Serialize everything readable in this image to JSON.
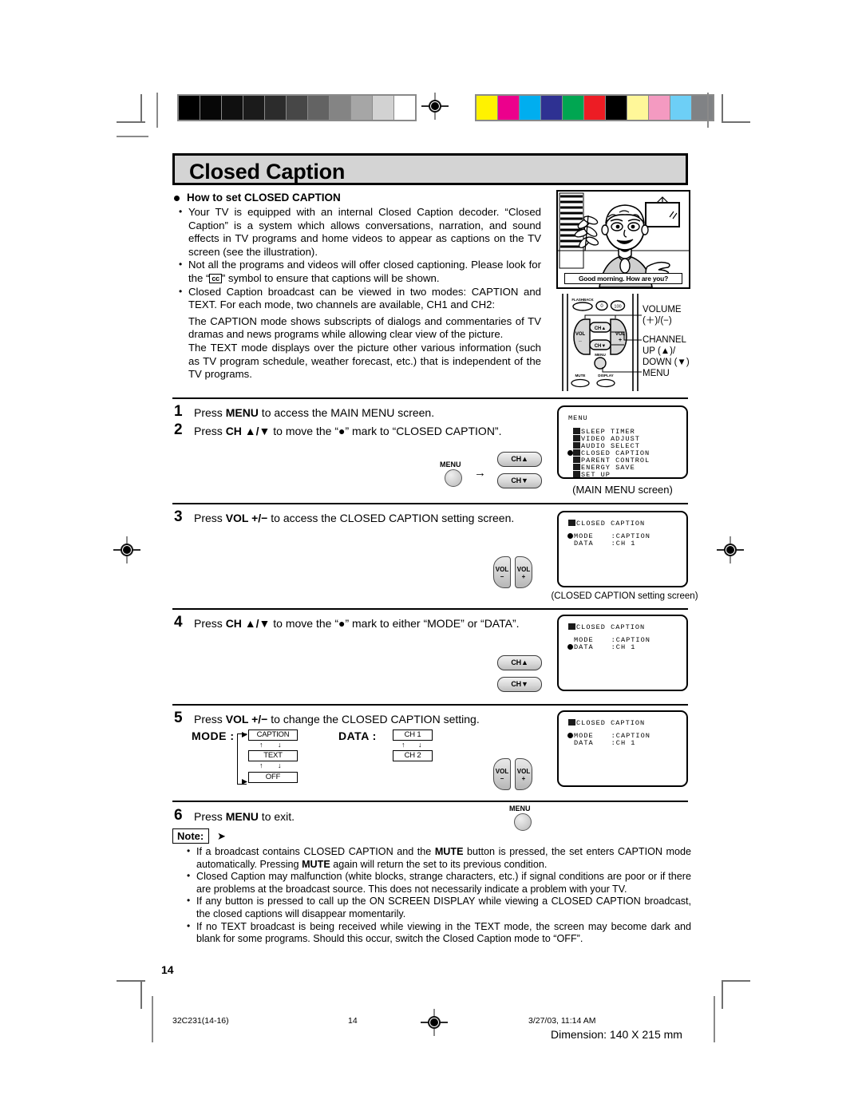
{
  "document": {
    "title": "Closed Caption",
    "page_number": "14"
  },
  "calibration": {
    "grayscale_swatches": [
      "#000000",
      "#070707",
      "#101010",
      "#1b1b1b",
      "#2c2c2c",
      "#474747",
      "#636363",
      "#848484",
      "#a6a6a6",
      "#d2d2d2",
      "#ffffff"
    ],
    "color_swatches": [
      "#fff200",
      "#ec008c",
      "#00aeef",
      "#2e3192",
      "#00a651",
      "#ed1c24",
      "#000000",
      "#fff799",
      "#f49ac1",
      "#6dcff6",
      "#808285"
    ]
  },
  "section": {
    "heading": "How to set CLOSED CAPTION",
    "bullets": [
      "Your TV is equipped with an internal Closed Caption decoder. “Closed Caption” is a system which allows conversations, narration, and sound effects in TV programs and home videos to appear as captions on the TV screen (see the illustration).",
      "Not all the programs and videos will offer closed captioning. Please look for the “ cc ” symbol to ensure that captions will be shown.",
      "Closed Caption broadcast can be viewed in two modes: CAPTION and TEXT. For each mode, two channels are available, CH1 and CH2:"
    ],
    "bullet2_prefix": "Not all the programs and videos will offer closed captioning. Please look for the “",
    "bullet2_symbol": "cc",
    "bullet2_suffix": "” symbol to ensure that captions will be shown.",
    "paragraphs": [
      "The CAPTION mode shows subscripts of dialogs and commentaries of TV dramas and news programs while allowing clear view of the picture.",
      "The TEXT mode displays over the picture other various information (such as TV program schedule, weather forecast, etc.) that is independent of the TV programs."
    ]
  },
  "illustration": {
    "caption_text": "Good morning. How are you?"
  },
  "remote": {
    "buttons": {
      "flashback": "FLASHBACK",
      "zero": "0",
      "hundred": "100",
      "vol_minus": "VOL",
      "vol_minus_sign": "−",
      "vol_plus": "VOL",
      "vol_plus_sign": "+",
      "ch_up": "CH▲",
      "ch_down": "CH▼",
      "menu": "MENU",
      "mute": "MUTE",
      "display": "DISPLAY"
    },
    "callouts": [
      "VOLUME",
      "(＋)/(−)",
      "CHANNEL",
      "UP (▲)/",
      "DOWN (▼)",
      "MENU"
    ]
  },
  "main_menu_screen": {
    "title": "MENU",
    "items": [
      {
        "label": "SLEEP TIMER",
        "selected": false
      },
      {
        "label": "VIDEO ADJUST",
        "selected": false
      },
      {
        "label": "AUDIO SELECT",
        "selected": false
      },
      {
        "label": "CLOSED CAPTION",
        "selected": true
      },
      {
        "label": "PARENT CONTROL",
        "selected": false
      },
      {
        "label": "ENERGY SAVE",
        "selected": false
      },
      {
        "label": "SET UP",
        "selected": false
      }
    ],
    "caption": "(MAIN  MENU  screen)"
  },
  "cc_screen_step3": {
    "title": "CLOSED CAPTION",
    "rows": [
      {
        "label": "MODE",
        "value": ":CAPTION",
        "selected": true
      },
      {
        "label": "DATA",
        "value": ":CH 1",
        "selected": false
      }
    ],
    "caption": "(CLOSED CAPTION setting screen)"
  },
  "cc_screen_step4": {
    "title": "CLOSED CAPTION",
    "rows": [
      {
        "label": "MODE",
        "value": ":CAPTION",
        "selected": false
      },
      {
        "label": "DATA",
        "value": ":CH 1",
        "selected": true
      }
    ]
  },
  "cc_screen_step5": {
    "title": "CLOSED CAPTION",
    "rows": [
      {
        "label": "MODE",
        "value": ":CAPTION",
        "selected": true
      },
      {
        "label": "DATA",
        "value": ":CH 1",
        "selected": false
      }
    ]
  },
  "steps": [
    {
      "num": "1",
      "text_pre": "Press ",
      "bold": "MENU",
      "text_post": " to access the MAIN MENU screen."
    },
    {
      "num": "2",
      "text_pre": "Press ",
      "bold": "CH ▲/▼",
      "text_post": " to move the “●” mark to “CLOSED CAPTION”."
    },
    {
      "num": "3",
      "text_pre": "Press ",
      "bold": "VOL +/−",
      "text_post": " to access the CLOSED CAPTION setting screen."
    },
    {
      "num": "4",
      "text_pre": "Press ",
      "bold": "CH ▲/▼",
      "text_post": " to move the “●” mark to either “MODE” or “DATA”."
    },
    {
      "num": "5",
      "text_pre": "Press ",
      "bold": "VOL +/−",
      "text_post": " to change the CLOSED CAPTION setting."
    },
    {
      "num": "6",
      "text_pre": "Press ",
      "bold": "MENU",
      "text_post": " to exit."
    }
  ],
  "mode_flow": {
    "label": "MODE :",
    "cells": [
      "CAPTION",
      "TEXT",
      "OFF"
    ],
    "arrow_up": "↑",
    "arrow_down": "↓"
  },
  "data_flow": {
    "label": "DATA :",
    "cells": [
      "CH 1",
      "CH 2"
    ],
    "arrow_up": "↑",
    "arrow_down": "↓"
  },
  "note": {
    "label": "Note:",
    "arrow": "➤",
    "items": [
      {
        "parts": [
          {
            "t": "If a broadcast contains CLOSED CAPTION and the ",
            "b": false
          },
          {
            "t": "MUTE",
            "b": true
          },
          {
            "t": " button is pressed, the set enters CAPTION mode automatically. Pressing ",
            "b": false
          },
          {
            "t": "MUTE",
            "b": true
          },
          {
            "t": " again will return the set to its previous condition.",
            "b": false
          }
        ]
      },
      {
        "parts": [
          {
            "t": "Closed Caption may malfunction (white blocks, strange characters, etc.) if signal conditions are poor or if there are problems at the broadcast source. This does not necessarily indicate a problem with your TV.",
            "b": false
          }
        ]
      },
      {
        "parts": [
          {
            "t": "If any button is pressed to call up the ON SCREEN DISPLAY while viewing a CLOSED CAPTION broadcast, the closed captions will disappear momentarily.",
            "b": false
          }
        ]
      },
      {
        "parts": [
          {
            "t": "If no TEXT broadcast is being received while viewing in the TEXT mode, the screen may become dark and blank for some programs. Should this occur, switch the Closed Caption mode to “OFF”.",
            "b": false
          }
        ]
      }
    ]
  },
  "footer": {
    "file_code": "32C231(14-16)",
    "page": "14",
    "timestamp": "3/27/03, 11:14 AM",
    "dimension": "Dimension: 140  X 215 mm"
  }
}
